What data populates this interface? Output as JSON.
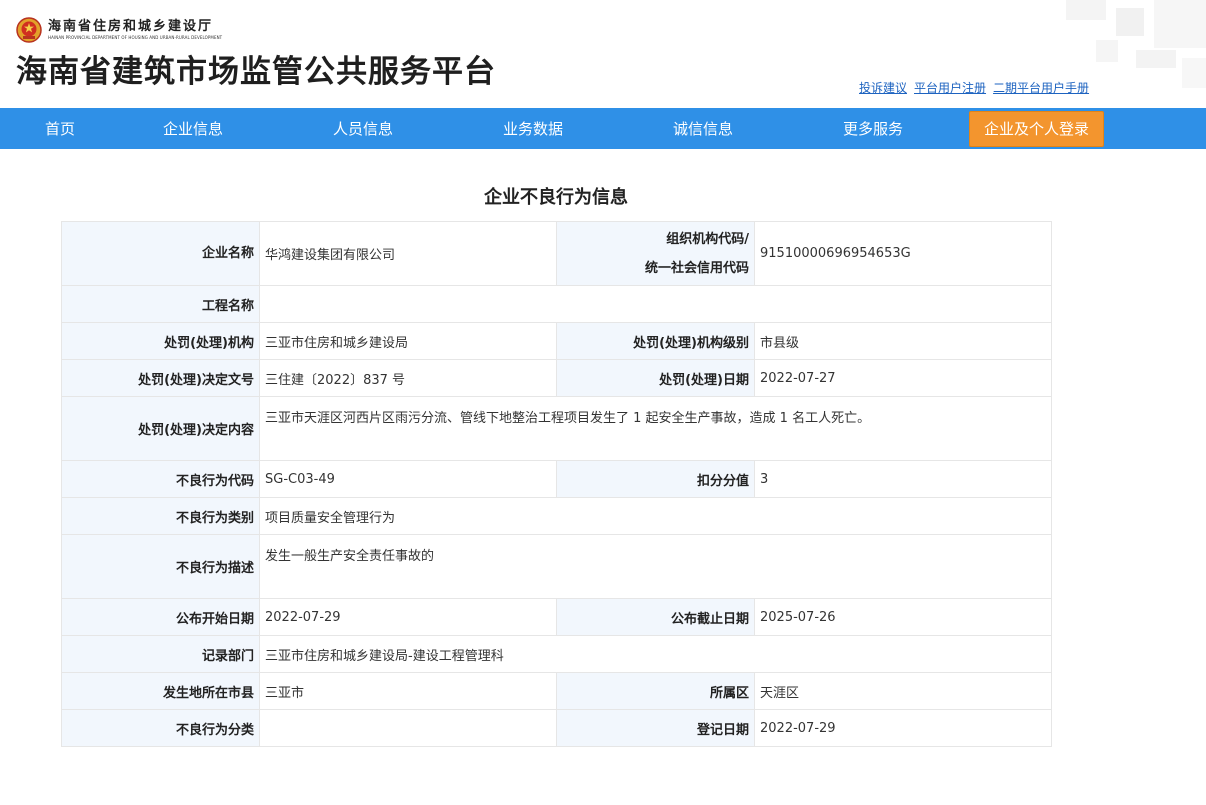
{
  "header": {
    "dept_name_cn": "海南省住房和城乡建设厅",
    "dept_name_en": "HAINAN PROVINCIAL DEPARTMENT OF HOUSING AND URBAN-RURAL DEVELOPMENT",
    "site_title": "海南省建筑市场监管公共服务平台",
    "links": [
      "投诉建议",
      "平台用户注册",
      "二期平台用户手册"
    ]
  },
  "nav": {
    "items": [
      "首页",
      "企业信息",
      "人员信息",
      "业务数据",
      "诚信信息",
      "更多服务"
    ],
    "login_label": "企业及个人登录",
    "color": "#2f90e7",
    "login_color": "#f3952e"
  },
  "page_title": "企业不良行为信息",
  "record": {
    "company_name_label": "企业名称",
    "company_name": "华鸿建设集团有限公司",
    "org_code_label_1": "组织机构代码/",
    "org_code_label_2": "统一社会信用代码",
    "org_code": "91510000696954653G",
    "project_name_label": "工程名称",
    "project_name": "",
    "penalty_org_label": "处罚(处理)机构",
    "penalty_org": "三亚市住房和城乡建设局",
    "penalty_level_label": "处罚(处理)机构级别",
    "penalty_level": "市县级",
    "decision_no_label": "处罚(处理)决定文号",
    "decision_no": "三住建〔2022〕837 号",
    "penalty_date_label": "处罚(处理)日期",
    "penalty_date": "2022-07-27",
    "decision_content_label": "处罚(处理)决定内容",
    "decision_content": "三亚市天涯区河西片区雨污分流、管线下地整治工程项目发生了 1 起安全生产事故，造成 1 名工人死亡。",
    "behavior_code_label": "不良行为代码",
    "behavior_code": "SG-C03-49",
    "deduction_label": "扣分分值",
    "deduction": "3",
    "behavior_type_label": "不良行为类别",
    "behavior_type": "项目质量安全管理行为",
    "behavior_desc_label": "不良行为描述",
    "behavior_desc": "发生一般生产安全责任事故的",
    "publish_start_label": "公布开始日期",
    "publish_start": "2022-07-29",
    "publish_end_label": "公布截止日期",
    "publish_end": "2025-07-26",
    "record_dept_label": "记录部门",
    "record_dept": "三亚市住房和城乡建设局-建设工程管理科",
    "city_label": "发生地所在市县",
    "city": "三亚市",
    "district_label": "所属区",
    "district": "天涯区",
    "category_label": "不良行为分类",
    "category": "",
    "register_date_label": "登记日期",
    "register_date": "2022-07-29"
  }
}
